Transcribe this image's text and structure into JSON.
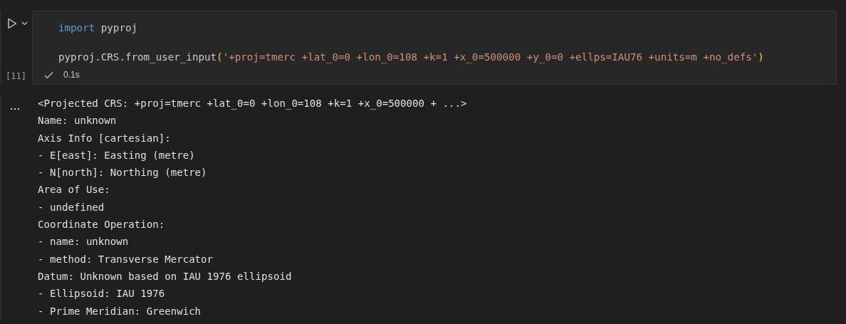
{
  "cell": {
    "execution_count": "[11]",
    "status": {
      "succeeded": true,
      "duration": "0.1s"
    },
    "code_lines": [
      [
        {
          "kind": "keyword",
          "text": "import"
        },
        {
          "kind": "plain",
          "text": " pyproj"
        }
      ],
      [
        {
          "kind": "plain",
          "text": "pyproj.CRS.from_user_input"
        },
        {
          "kind": "bracket",
          "text": "("
        },
        {
          "kind": "string",
          "text": "'+proj=tmerc +lat_0=0 +lon_0=108 +k=1 +x_0=500000 +y_0=0 +ellps=IAU76 +units=m +no_defs'"
        },
        {
          "kind": "bracket",
          "text": ")"
        }
      ]
    ],
    "output_lines": [
      "<Projected CRS: +proj=tmerc +lat_0=0 +lon_0=108 +k=1 +x_0=500000 + ...>",
      "Name: unknown",
      "Axis Info [cartesian]:",
      "- E[east]: Easting (metre)",
      "- N[north]: Northing (metre)",
      "Area of Use:",
      "- undefined",
      "Coordinate Operation:",
      "- name: unknown",
      "- method: Transverse Mercator",
      "Datum: Unknown based on IAU 1976 ellipsoid",
      "- Ellipsoid: IAU 1976",
      "- Prime Meridian: Greenwich"
    ]
  }
}
